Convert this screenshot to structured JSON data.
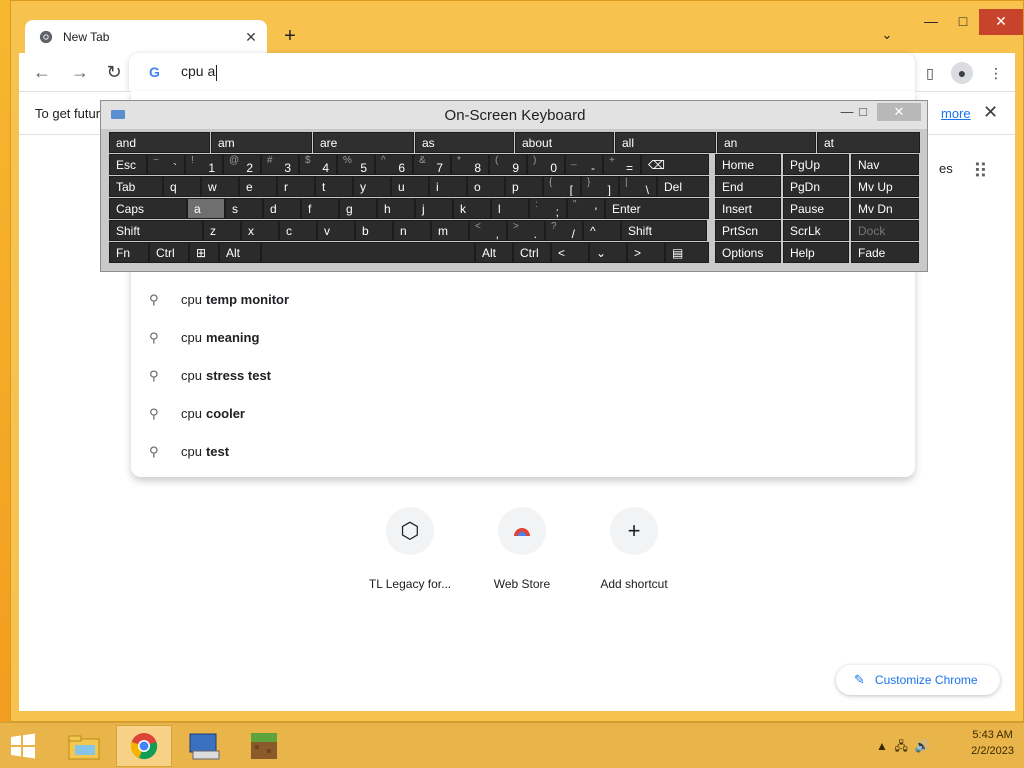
{
  "browser": {
    "tab_title": "New Tab",
    "tab_close": "✕",
    "new_tab": "+",
    "tab_search": "⌄",
    "window_controls": {
      "minimize": "—",
      "maximize": "□",
      "close": "✕"
    },
    "omnibox_value": "cpu a",
    "infobar_text": "To get futur",
    "infobar_link": "more",
    "infobar_close": "✕",
    "apps_partial": "es"
  },
  "suggestions": [
    {
      "prefix": "cpu",
      "bold": "temp monitor"
    },
    {
      "prefix": "cpu",
      "bold": "meaning"
    },
    {
      "prefix": "cpu",
      "bold": "stress test"
    },
    {
      "prefix": "cpu",
      "bold": "cooler"
    },
    {
      "prefix": "cpu",
      "bold": "test"
    }
  ],
  "shortcuts": [
    {
      "label": "TL Legacy for...",
      "icon": "cube-icon"
    },
    {
      "label": "Web Store",
      "icon": "chrome-web-store-icon"
    },
    {
      "label": "Add shortcut",
      "icon": "plus-icon"
    }
  ],
  "customize_label": "Customize Chrome",
  "osk": {
    "title": "On-Screen Keyboard",
    "predictions": [
      "and",
      "am",
      "are",
      "as",
      "about",
      "all",
      "an",
      "at"
    ],
    "row1": [
      [
        "Esc",
        ""
      ],
      [
        "~",
        "`"
      ],
      [
        "!",
        "1"
      ],
      [
        "@",
        "2"
      ],
      [
        "#",
        "3"
      ],
      [
        "$",
        "4"
      ],
      [
        "%",
        "5"
      ],
      [
        "^",
        "6"
      ],
      [
        "&",
        "7"
      ],
      [
        "*",
        "8"
      ],
      [
        "(",
        "9"
      ],
      [
        ")",
        "0"
      ],
      [
        "_",
        "-"
      ],
      [
        "+",
        "="
      ]
    ],
    "row2": [
      "Tab",
      "q",
      "w",
      "e",
      "r",
      "t",
      "y",
      "u",
      "i",
      "o",
      "p"
    ],
    "row2_extra": [
      [
        "{",
        "["
      ],
      [
        "}",
        "]"
      ],
      [
        "|",
        "\\"
      ],
      [
        "",
        "Del"
      ]
    ],
    "row3": [
      "Caps",
      "a",
      "s",
      "d",
      "f",
      "g",
      "h",
      "j",
      "k",
      "l"
    ],
    "row3_extra": [
      [
        ":",
        ";"
      ],
      [
        "\"",
        "'"
      ],
      [
        "",
        "Enter"
      ]
    ],
    "row4": [
      "Shift",
      "z",
      "x",
      "c",
      "v",
      "b",
      "n",
      "m"
    ],
    "row4_extra": [
      [
        "<",
        ","
      ],
      [
        ">",
        "."
      ],
      [
        "?",
        "/"
      ],
      [
        "",
        "^"
      ],
      [
        "",
        "Shift"
      ]
    ],
    "row5": [
      "Fn",
      "Ctrl",
      "",
      "Alt",
      "",
      "Alt",
      "Ctrl",
      "<",
      "v",
      ">",
      ""
    ],
    "nav_keys": [
      [
        "Home",
        "PgUp",
        "Nav"
      ],
      [
        "End",
        "PgDn",
        "Mv Up"
      ],
      [
        "Insert",
        "Pause",
        "Mv Dn"
      ],
      [
        "PrtScn",
        "ScrLk",
        "Dock"
      ],
      [
        "Options",
        "Help",
        "Fade"
      ]
    ]
  },
  "taskbar": {
    "time": "5:43 AM",
    "date": "2/2/2023"
  }
}
